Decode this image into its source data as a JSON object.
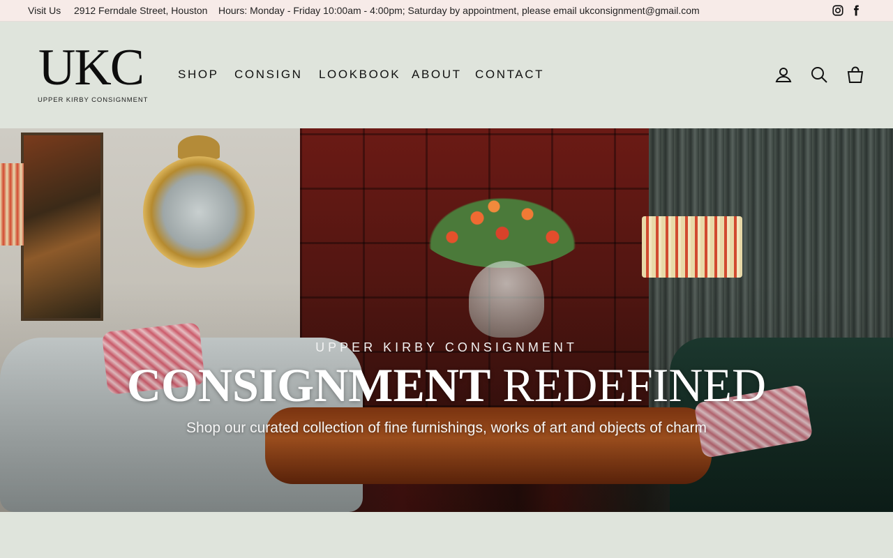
{
  "announcement": {
    "visit_label": "Visit Us",
    "address": "2912 Ferndale Street, Houston",
    "hours": "Hours: Monday - Friday 10:00am - 4:00pm; Saturday by appointment, please email ukconsignment@gmail.com",
    "social": [
      {
        "name": "Instagram",
        "icon": "instagram-icon"
      },
      {
        "name": "Facebook",
        "icon": "facebook-icon"
      }
    ]
  },
  "header": {
    "logo_mark": "UKC",
    "logo_subtitle": "UPPER KIRBY CONSIGNMENT",
    "nav": [
      "SHOP",
      "CONSIGN",
      "LOOKBOOK",
      "ABOUT",
      "CONTACT"
    ],
    "icons": [
      "account-icon",
      "search-icon",
      "cart-icon"
    ]
  },
  "hero": {
    "kicker": "UPPER KIRBY CONSIGNMENT",
    "headline_bold": "CONSIGNMENT",
    "headline_regular": "REDEFINED",
    "tagline": "Shop our curated collection of fine furnishings, works of art and objects of charm"
  },
  "colors": {
    "announcement_bg": "#f7ebe8",
    "header_bg": "#dfe4dc",
    "text": "#111111",
    "hero_text": "#ffffff"
  }
}
